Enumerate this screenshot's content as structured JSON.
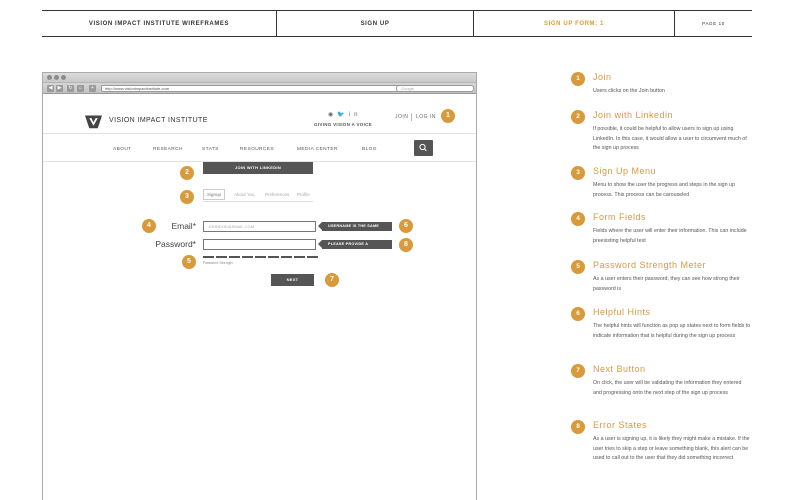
{
  "header": {
    "title": "VISION IMPACT INSTITUTE WIREFRAMES",
    "section": "SIGN UP",
    "page_name": "SIGN UP FORM: 1",
    "page_number": "PAGE 10"
  },
  "browser": {
    "url": "http://www.visionimpactinstitute.com",
    "search_placeholder": "Google"
  },
  "site": {
    "logo_text": "VISION IMPACT INSTITUTE",
    "social_icons": [
      "eye-icon",
      "twitter-icon",
      "linkedin-icon"
    ],
    "tagline": "GIVING VISION A VOICE",
    "join": "JOIN",
    "login": "LOG IN",
    "menu": [
      "ABOUT",
      "RESEARCH",
      "STATS",
      "RESOURCES",
      "MEDIA CENTER",
      "BLOG"
    ],
    "linkedin_button": "JOIN WITH LINKEDIN",
    "steps": [
      "Signup",
      "About You",
      "Preferences",
      "Profile"
    ],
    "email_label": "Email*",
    "email_placeholder": "JOHNDOE@EMAIL.COM",
    "email_hint": "USERNAME IS THE SAME",
    "password_label": "Password*",
    "password_hint": "PLEASE PROVIDE A PASSWORD",
    "strength_label": "Password Strength",
    "next_button": "NEXT"
  },
  "badges": {
    "b1": "1",
    "b2": "2",
    "b3": "3",
    "b4": "4",
    "b5": "5",
    "b6": "6",
    "b7": "7",
    "b8": "8"
  },
  "annotations": [
    {
      "num": "1",
      "title": "Join",
      "body": "Users clicks on the Join button"
    },
    {
      "num": "2",
      "title": "Join with Linkedin",
      "body": "If possible, it could be helpful to allow users to sign up using LinkedIn. In this case, it would allow a user to circumvent much of the sign up process"
    },
    {
      "num": "3",
      "title": "Sign Up Menu",
      "body": "Menu to show the user the progress and steps in the sign up process. This process can be carouseled"
    },
    {
      "num": "4",
      "title": "Form Fields",
      "body": "Fields where the user will enter their information. This can include preexisting helpful text"
    },
    {
      "num": "5",
      "title": "Password Strength Meter",
      "body": "As a user enters their password, they can see how strong their password is"
    },
    {
      "num": "6",
      "title": "Helpful Hints",
      "body": "The helpful hints will function as pop up states next to form fields to indicate information that is helpful during the sign up process"
    },
    {
      "num": "7",
      "title": "Next Button",
      "body": "On click, the user will be validating the information they entered and progressing onto the next step of the sign up process"
    },
    {
      "num": "8",
      "title": "Error States",
      "body": "As a user is signing up, it is likely they might make a mistake. If the user tries to skip a step or leave something blank, this alert can be used to call out to the user that they did something incorrect"
    }
  ],
  "colors": {
    "accent": "#d89a3a",
    "dark": "#555555"
  }
}
